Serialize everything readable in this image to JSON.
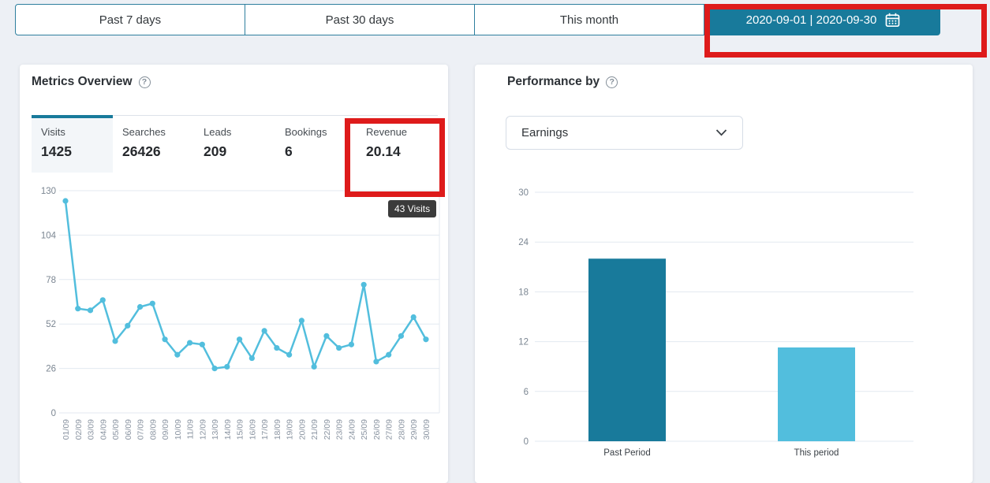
{
  "topbar": {
    "tabs": [
      {
        "label": "Past 7 days"
      },
      {
        "label": "Past 30 days"
      },
      {
        "label": "This month"
      },
      {
        "label": "2020-09-01 | 2020-09-30",
        "selected": true
      }
    ]
  },
  "icons": {
    "help": "?"
  },
  "colors": {
    "teal": "#187a9b",
    "light_blue": "#52bedd",
    "annotation_red": "#de1b1b",
    "tooltip_bg": "#3b3b3b",
    "gridline": "#e3e9f0",
    "axis_text": "#7b8692"
  },
  "metrics_card": {
    "title": "Metrics Overview",
    "metrics": [
      {
        "label": "Visits",
        "value": "1425",
        "selected": true
      },
      {
        "label": "Searches",
        "value": "26426"
      },
      {
        "label": "Leads",
        "value": "209"
      },
      {
        "label": "Bookings",
        "value": "6"
      },
      {
        "label": "Revenue",
        "value": "20.14"
      }
    ],
    "tooltip": "43 Visits"
  },
  "performance_card": {
    "title": "Performance by",
    "dropdown_value": "Earnings"
  },
  "chart_data": [
    {
      "type": "line",
      "title": "Visits per day (Metrics Overview)",
      "x": [
        "01/09",
        "02/09",
        "03/09",
        "04/09",
        "05/09",
        "06/09",
        "07/09",
        "08/09",
        "09/09",
        "10/09",
        "11/09",
        "12/09",
        "13/09",
        "14/09",
        "15/09",
        "16/09",
        "17/09",
        "18/09",
        "19/09",
        "20/09",
        "21/09",
        "22/09",
        "23/09",
        "24/09",
        "25/09",
        "26/09",
        "27/09",
        "28/09",
        "29/09",
        "30/09"
      ],
      "values": [
        124,
        61,
        60,
        66,
        42,
        51,
        62,
        64,
        43,
        34,
        41,
        40,
        26,
        27,
        43,
        32,
        48,
        38,
        34,
        54,
        27,
        45,
        38,
        40,
        75,
        30,
        34,
        45,
        56,
        43
      ],
      "ylim": [
        0,
        130
      ],
      "yticks": [
        0,
        26,
        52,
        78,
        104,
        130
      ],
      "grid": true,
      "line_color": "#52bedd",
      "tooltip": {
        "index": 8,
        "label": "43 Visits"
      }
    },
    {
      "type": "bar",
      "title": "Performance by Earnings",
      "categories": [
        "Past Period",
        "This period"
      ],
      "values": [
        22,
        11.3
      ],
      "bar_colors": [
        "#187a9b",
        "#52bedd"
      ],
      "ylim": [
        0,
        30
      ],
      "yticks": [
        0,
        6,
        12,
        18,
        24,
        30
      ],
      "grid": true
    }
  ]
}
